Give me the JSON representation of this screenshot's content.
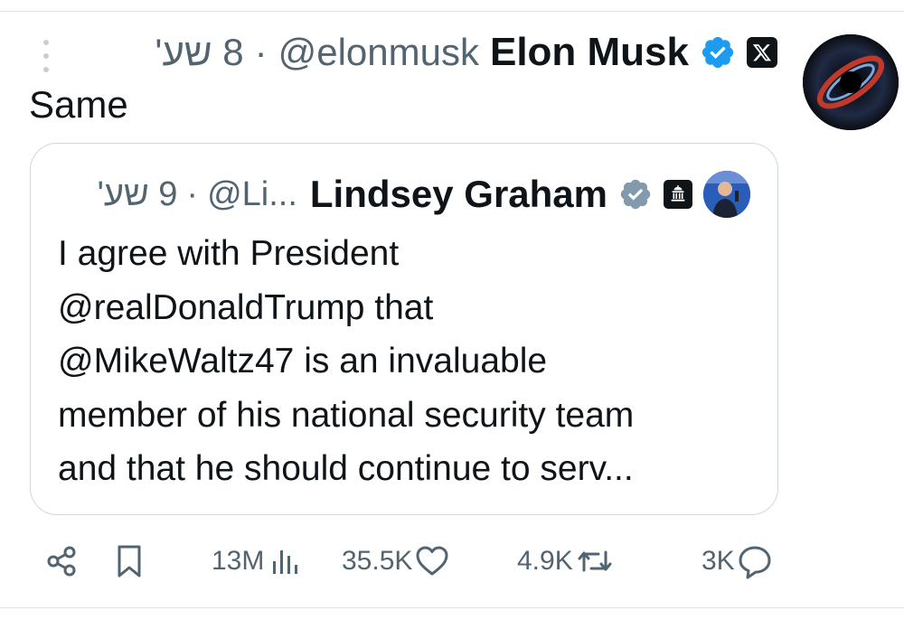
{
  "tweet": {
    "author_name": "Elon Musk",
    "handle": "@elonmusk",
    "time": "8 שע'",
    "separator": "·",
    "text": "Same",
    "verified_color": "#1d9bf0"
  },
  "quoted": {
    "author_name": "Lindsey Graham",
    "handle": "@Li...",
    "time": "9 שע'",
    "separator": "·",
    "lines": [
      "I agree with President",
      "@realDonaldTrump that",
      "@MikeWaltz47 is an invaluable",
      "member of his national security team",
      "and that he should continue to serv..."
    ],
    "verified_color": "#829aab"
  },
  "actions": {
    "replies": "3K",
    "reposts": "4.9K",
    "likes": "35.5K",
    "views": "13M"
  },
  "icons": [
    "more-icon",
    "verified-badge-icon",
    "x-logo-icon",
    "government-badge-icon",
    "share-icon",
    "bookmark-icon",
    "views-icon",
    "like-icon",
    "repost-icon",
    "reply-icon"
  ]
}
